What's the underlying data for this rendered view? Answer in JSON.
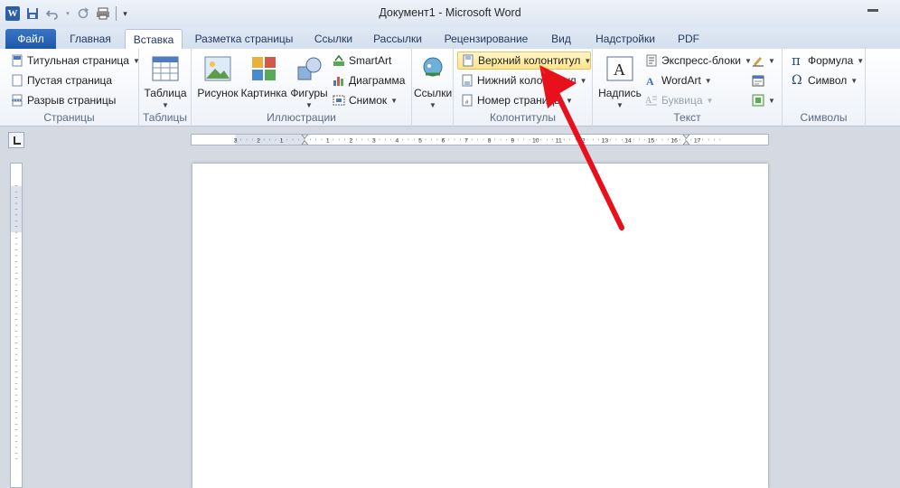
{
  "window": {
    "title": "Документ1  -  Microsoft Word"
  },
  "quick_access": {
    "icons": [
      "word-logo-icon",
      "save-icon",
      "undo-icon",
      "redo-icon",
      "print-icon",
      "customize-icon"
    ],
    "word_logo_letter": "W"
  },
  "tabs": [
    {
      "label": "Файл"
    },
    {
      "label": "Главная"
    },
    {
      "label": "Вставка",
      "active": true
    },
    {
      "label": "Разметка страницы"
    },
    {
      "label": "Ссылки"
    },
    {
      "label": "Рассылки"
    },
    {
      "label": "Рецензирование"
    },
    {
      "label": "Вид"
    },
    {
      "label": "Надстройки"
    },
    {
      "label": "PDF"
    }
  ],
  "ribbon": {
    "pages": {
      "label": "Страницы",
      "cover_page": "Титульная страница",
      "blank_page": "Пустая страница",
      "page_break": "Разрыв страницы"
    },
    "tables": {
      "label": "Таблицы",
      "table": "Таблица"
    },
    "illustrations": {
      "label": "Иллюстрации",
      "picture": "Рисунок",
      "clipart": "Картинка",
      "shapes": "Фигуры",
      "smartart": "SmartArt",
      "chart": "Диаграмма",
      "screenshot": "Снимок"
    },
    "links": {
      "links": "Ссылки"
    },
    "header_footer": {
      "label": "Колонтитулы",
      "header": "Верхний колонтитул",
      "footer": "Нижний колонтитул",
      "page_number": "Номер страницы"
    },
    "text": {
      "label": "Текст",
      "textbox": "Надпись",
      "quick_parts": "Экспресс-блоки",
      "wordart": "WordArt",
      "dropcap": "Буквица"
    },
    "symbols": {
      "label": "Символы",
      "equation": "Формула",
      "symbol": "Символ",
      "pi": "π",
      "omega": "Ω"
    }
  },
  "ruler": {
    "labels": [
      "3",
      "2",
      "1",
      "1",
      "2",
      "3",
      "4",
      "5",
      "6",
      "7",
      "8",
      "9",
      "10",
      "11",
      "12",
      "13",
      "14",
      "15",
      "16",
      "17"
    ]
  },
  "colors": {
    "accent": "#2b579a",
    "file_tab": "#1f58a8",
    "highlight": "#ffe48a",
    "arrow": "#e8101a"
  }
}
